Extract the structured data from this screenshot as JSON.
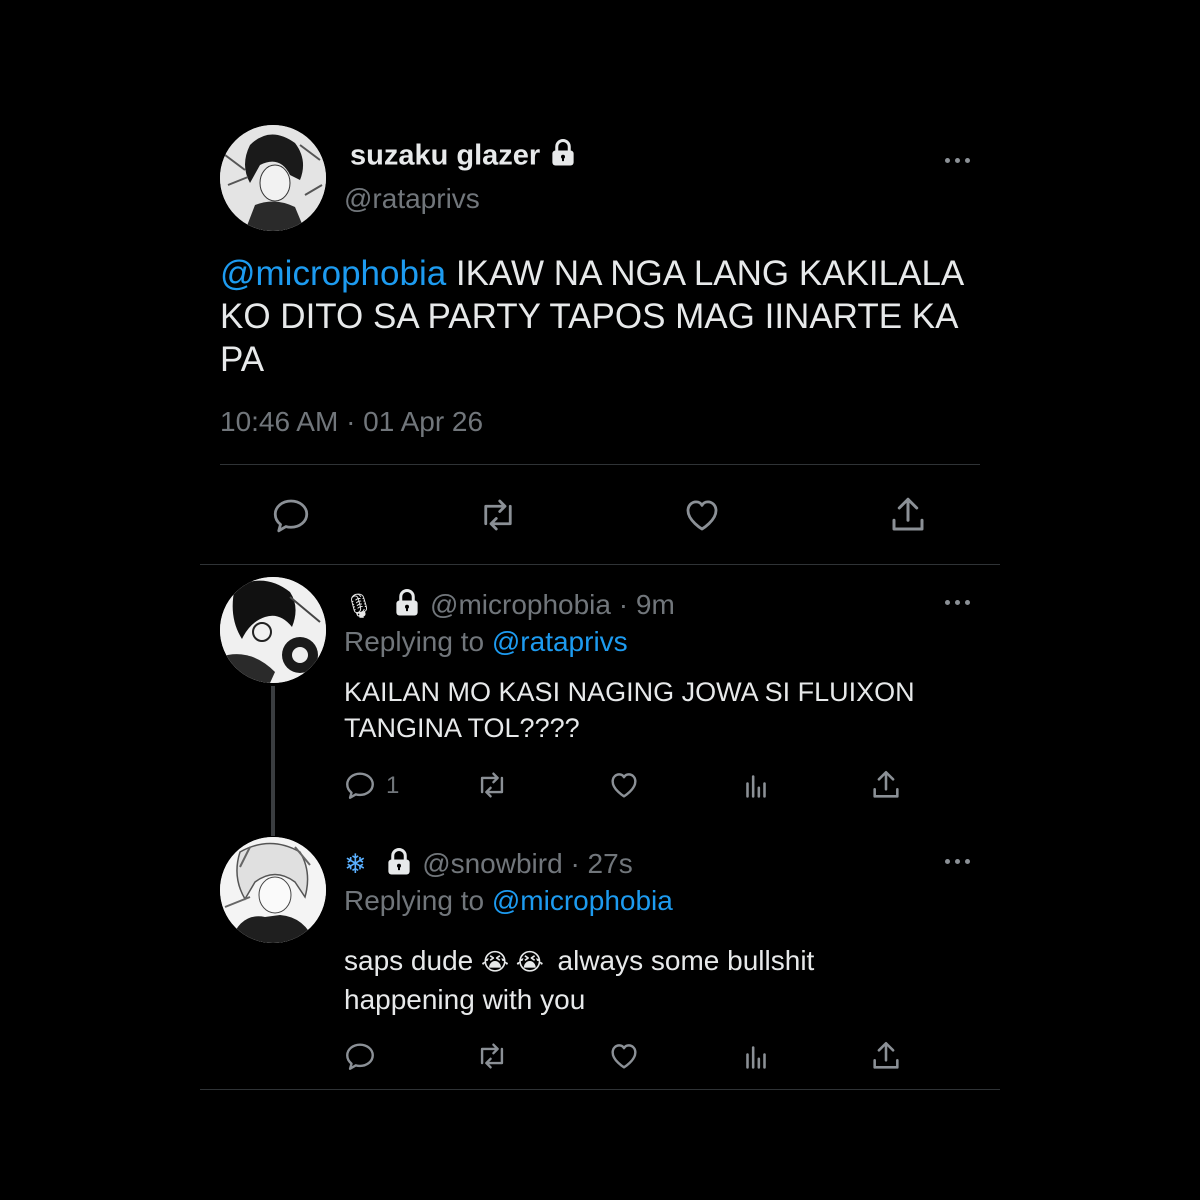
{
  "main_tweet": {
    "display_name": "suzaku glazer",
    "handle": "@rataprivs",
    "mention": "@microphobia",
    "text": "IKAW NA NGA LANG KAKILALA KO DITO SA PARTY TAPOS MAG IINARTE KA PA",
    "timestamp": "10:46 AM · 01 Apr 26"
  },
  "replies": [
    {
      "name_emoji": "🎙",
      "handle": "@microphobia",
      "time": "· 9m",
      "replying_prefix": "Replying to",
      "replying_to": "@rataprivs",
      "text_line1": "KAILAN MO KASI NAGING JOWA SI FLUIXON",
      "text_line2": "TANGINA TOL????",
      "reply_count": "1"
    },
    {
      "name_emoji": "❄",
      "handle": "@snowbird",
      "time": "· 27s",
      "replying_prefix": "Replying to",
      "replying_to": "@microphobia",
      "text_line1_a": "saps dude",
      "text_emoji": "😭 😭",
      "text_line1_b": "always some bullshit",
      "text_line2": "happening with you"
    }
  ],
  "colors": {
    "background": "#000000",
    "text": "#e7e9ea",
    "muted": "#71767b",
    "link": "#1d9bf0"
  },
  "icons": [
    "lock-icon",
    "more-icon",
    "reply-icon",
    "retweet-icon",
    "like-icon",
    "share-icon",
    "views-icon"
  ]
}
